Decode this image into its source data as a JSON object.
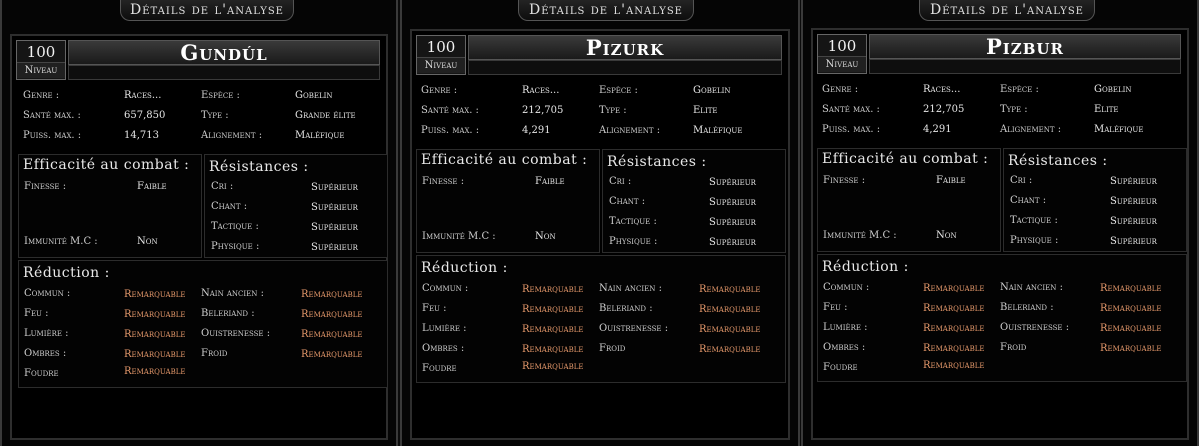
{
  "window_title": "Détails de l'analyse",
  "labels": {
    "level": "Niveau",
    "genre": "Genre :",
    "espece": "Espèce :",
    "sante": "Santé max. :",
    "type": "Type :",
    "puiss": "Puiss. max. :",
    "alignement": "Alignement :",
    "efficacite": "Efficacité au combat :",
    "finesse": "Finesse :",
    "immunite": "Immunité M.C :",
    "resistances": "Résistances :",
    "cri": "Cri :",
    "chant": "Chant :",
    "tactique": "Tactique :",
    "physique": "Physique :",
    "reduction": "Réduction :",
    "commun": "Commun :",
    "feu": "Feu :",
    "lumiere": "Lumière :",
    "ombres": "Ombres :",
    "foudre": "Foudre",
    "nain_ancien": "Nain ancien :",
    "beleriand": "Beleriand :",
    "ouistrenesse": "Ouistrenesse :",
    "froid": "Froid"
  },
  "panels": [
    {
      "name": "Gundúl",
      "level": "100",
      "genre": "Races...",
      "espece": "Gobelin",
      "sante": "657,850",
      "type": "Grande élite",
      "puiss": "14,713",
      "alignement": "Maléfique",
      "finesse": "Faible",
      "immunite": "Non",
      "cri": "Supérieur",
      "chant": "Supérieur",
      "tactique": "Supérieur",
      "physique": "Supérieur",
      "commun": "Remarquable",
      "feu": "Remarquable",
      "lumiere": "Remarquable",
      "ombres": "Remarquable",
      "foudre": "Remarquable",
      "nain_ancien": "Remarquable",
      "beleriand": "Remarquable",
      "ouistrenesse": "Remarquable",
      "froid": "Remarquable"
    },
    {
      "name": "Pizurk",
      "level": "100",
      "genre": "Races...",
      "espece": "Gobelin",
      "sante": "212,705",
      "type": "Elite",
      "puiss": "4,291",
      "alignement": "Maléfique",
      "finesse": "Faible",
      "immunite": "Non",
      "cri": "Supérieur",
      "chant": "Supérieur",
      "tactique": "Supérieur",
      "physique": "Supérieur",
      "commun": "Remarquable",
      "feu": "Remarquable",
      "lumiere": "Remarquable",
      "ombres": "Remarquable",
      "foudre": "Remarquable",
      "nain_ancien": "Remarquable",
      "beleriand": "Remarquable",
      "ouistrenesse": "Remarquable",
      "froid": "Remarquable"
    },
    {
      "name": "Pizbur",
      "level": "100",
      "genre": "Races...",
      "espece": "Gobelin",
      "sante": "212,705",
      "type": "Elite",
      "puiss": "4,291",
      "alignement": "Maléfique",
      "finesse": "Faible",
      "immunite": "Non",
      "cri": "Supérieur",
      "chant": "Supérieur",
      "tactique": "Supérieur",
      "physique": "Supérieur",
      "commun": "Remarquable",
      "feu": "Remarquable",
      "lumiere": "Remarquable",
      "ombres": "Remarquable",
      "foudre": "Remarquable",
      "nain_ancien": "Remarquable",
      "beleriand": "Remarquable",
      "ouistrenesse": "Remarquable",
      "froid": "Remarquable"
    }
  ]
}
